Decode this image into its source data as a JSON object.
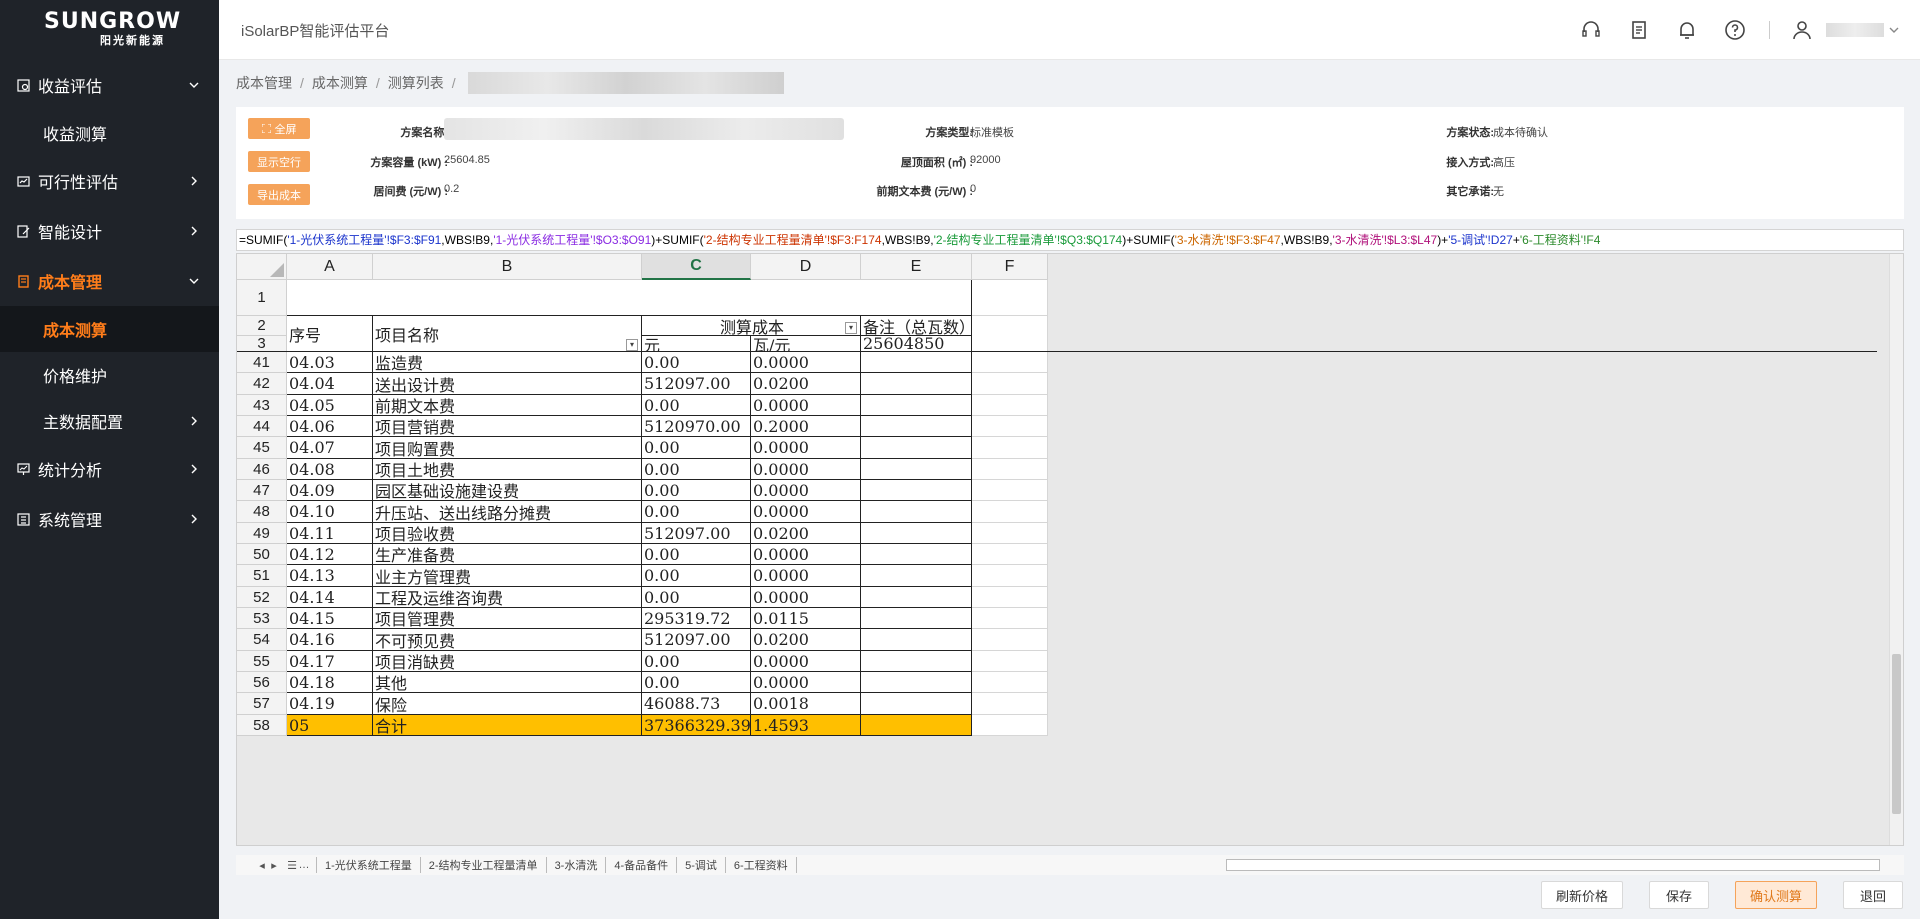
{
  "brand": {
    "name": "SUNGROW",
    "sub": "阳光新能源"
  },
  "header": {
    "platform": "iSolarBP智能评估平台"
  },
  "sidebar": {
    "items": [
      {
        "label": "收益评估",
        "icon": "revenue-icon",
        "expanded": true,
        "children": [
          {
            "label": "收益测算"
          }
        ]
      },
      {
        "label": "可行性评估",
        "icon": "feasibility-icon"
      },
      {
        "label": "智能设计",
        "icon": "design-icon"
      },
      {
        "label": "成本管理",
        "icon": "cost-icon",
        "active": true,
        "children": [
          {
            "label": "成本测算",
            "selected": true
          },
          {
            "label": "价格维护"
          },
          {
            "label": "主数据配置"
          }
        ]
      },
      {
        "label": "统计分析",
        "icon": "stats-icon"
      },
      {
        "label": "系统管理",
        "icon": "system-icon"
      }
    ]
  },
  "breadcrumb": [
    "成本管理",
    "成本测算",
    "测算列表"
  ],
  "actions": {
    "fullscreen": "全屏",
    "show_empty": "显示空行",
    "export": "导出成本"
  },
  "info": {
    "plan_name_label": "方案名称:",
    "capacity_label": "方案容量 (kW) :",
    "capacity_value": "25604.85",
    "fee_label": "居间费 (元/W) :",
    "fee_value": "0.2",
    "type_label": "方案类型:",
    "type_value": "标准模板",
    "roof_label": "屋顶面积 (㎡) :",
    "roof_value": "92000",
    "prelim_label": "前期文本费 (元/W) :",
    "prelim_value": "0",
    "status_label": "方案状态:",
    "status_value": "成本待确认",
    "access_label": "接入方式:",
    "access_value": "高压",
    "other_label": "其它承诺:",
    "other_value": "无"
  },
  "formula": [
    {
      "t": "=SUMIF(",
      "c": "#000"
    },
    {
      "t": "'1-光伏系统工程量'!$F3:$F91",
      "c": "#1a33cc"
    },
    {
      "t": ",WBS!B9,",
      "c": "#000"
    },
    {
      "t": "'1-光伏系统工程量'!$O3:$O91",
      "c": "#8a2be2"
    },
    {
      "t": ")+SUMIF(",
      "c": "#000"
    },
    {
      "t": "'2-结构专业工程量清单'!$F3:F174",
      "c": "#cc3300"
    },
    {
      "t": ",WBS!B9,",
      "c": "#000"
    },
    {
      "t": "'2-结构专业工程量清单'!$Q3:$Q174",
      "c": "#1a9a3a"
    },
    {
      "t": ")+SUMIF(",
      "c": "#000"
    },
    {
      "t": "'3-水清洗'!$F3:$F47",
      "c": "#cc6600"
    },
    {
      "t": ",WBS!B9,",
      "c": "#000"
    },
    {
      "t": "'3-水清洗'!$L3:$L47",
      "c": "#b0107a"
    },
    {
      "t": ")+",
      "c": "#000"
    },
    {
      "t": "'5-调试'!D27",
      "c": "#1a33cc"
    },
    {
      "t": "+",
      "c": "#000"
    },
    {
      "t": "'6-工程资料'!F4",
      "c": "#2b8a2b"
    }
  ],
  "sheet": {
    "columns": [
      "A",
      "B",
      "C",
      "D",
      "E",
      "F"
    ],
    "selected_col": "C",
    "header_rows": {
      "r1": "1",
      "r2": "2",
      "r3": "3"
    },
    "headers": {
      "seq": "序号",
      "name": "项目名称",
      "cost": "测算成本",
      "note": "备注（总瓦数）",
      "unit_yuan": "元",
      "unit_w": "瓦/元",
      "total_watts": "25604850"
    },
    "rows": [
      {
        "r": "41",
        "a": "04.03",
        "b": "监造费",
        "c": "0.00",
        "d": "0.0000"
      },
      {
        "r": "42",
        "a": "04.04",
        "b": "送出设计费",
        "c": "512097.00",
        "d": "0.0200"
      },
      {
        "r": "43",
        "a": "04.05",
        "b": "前期文本费",
        "c": "0.00",
        "d": "0.0000"
      },
      {
        "r": "44",
        "a": "04.06",
        "b": "项目营销费",
        "c": "5120970.00",
        "d": "0.2000"
      },
      {
        "r": "45",
        "a": "04.07",
        "b": "项目购置费",
        "c": "0.00",
        "d": "0.0000"
      },
      {
        "r": "46",
        "a": "04.08",
        "b": "项目土地费",
        "c": "0.00",
        "d": "0.0000"
      },
      {
        "r": "47",
        "a": "04.09",
        "b": "园区基础设施建设费",
        "c": "0.00",
        "d": "0.0000"
      },
      {
        "r": "48",
        "a": "04.10",
        "b": "升压站、送出线路分摊费",
        "c": "0.00",
        "d": "0.0000"
      },
      {
        "r": "49",
        "a": "04.11",
        "b": "项目验收费",
        "c": "512097.00",
        "d": "0.0200"
      },
      {
        "r": "50",
        "a": "04.12",
        "b": "生产准备费",
        "c": "0.00",
        "d": "0.0000"
      },
      {
        "r": "51",
        "a": "04.13",
        "b": "业主方管理费",
        "c": "0.00",
        "d": "0.0000"
      },
      {
        "r": "52",
        "a": "04.14",
        "b": "工程及运维咨询费",
        "c": "0.00",
        "d": "0.0000"
      },
      {
        "r": "53",
        "a": "04.15",
        "b": "项目管理费",
        "c": "295319.72",
        "d": "0.0115"
      },
      {
        "r": "54",
        "a": "04.16",
        "b": "不可预见费",
        "c": "512097.00",
        "d": "0.0200"
      },
      {
        "r": "55",
        "a": "04.17",
        "b": "项目消缺费",
        "c": "0.00",
        "d": "0.0000"
      },
      {
        "r": "56",
        "a": "04.18",
        "b": "其他",
        "c": "0.00",
        "d": "0.0000"
      },
      {
        "r": "57",
        "a": "04.19",
        "b": "保险",
        "c": "46088.73",
        "d": "0.0018"
      },
      {
        "r": "58",
        "a": "05",
        "b": "合计",
        "c": "37366329.39",
        "d": "1.4593",
        "total": true
      }
    ]
  },
  "tabs": {
    "more": "…",
    "list": [
      "1-光伏系统工程量",
      "2-结构专业工程量清单",
      "3-水清洗",
      "4-备品备件",
      "5-调试",
      "6-工程资料"
    ]
  },
  "buttons": {
    "refresh": "刷新价格",
    "save": "保存",
    "confirm": "确认测算",
    "back": "退回"
  },
  "colors": {
    "accent": "#ff7d1a",
    "sidebar_bg": "#1f2329",
    "total_row": "#ffbf00"
  }
}
